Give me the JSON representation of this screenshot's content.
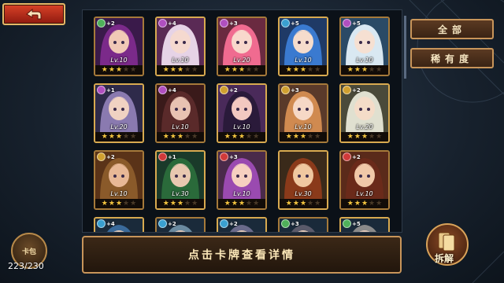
{
  "back_button": {
    "icon": "back-arrow-icon"
  },
  "filters": {
    "all": "全部",
    "rarity": "稀有度"
  },
  "bag": {
    "label": "卡包",
    "count": "223/230"
  },
  "hint": "点击卡牌查看详情",
  "decompose": {
    "label": "拆解"
  },
  "colors": {
    "frame_gold": "#d8aa50",
    "button_red": "#d94228",
    "star_gold": "#f3c43f"
  },
  "cards": [
    {
      "plus": "+2",
      "level": "Lv.10",
      "stars": 3,
      "gem": "#4fb05a",
      "hair": "#7b2a8a",
      "skin": "#f1c9b6",
      "bg": "#3a1a4a"
    },
    {
      "plus": "+4",
      "level": "Lv.10",
      "stars": 3,
      "gem": "#b04fc0",
      "hair": "#e6d3e6",
      "skin": "#f5d9cf",
      "bg": "#5a2a55"
    },
    {
      "plus": "+3",
      "level": "Lv.20",
      "stars": 3,
      "gem": "#b04fc0",
      "hair": "#f06b90",
      "skin": "#f8d8cc",
      "bg": "#6a2a40"
    },
    {
      "plus": "+5",
      "level": "Lv.10",
      "stars": 3,
      "gem": "#3aa0d0",
      "hair": "#3a7ad0",
      "skin": "#f5dccc",
      "bg": "#1f3a66"
    },
    {
      "plus": "+5",
      "level": "Lv.10",
      "stars": 3,
      "gem": "#b04fc0",
      "hair": "#d9e8f2",
      "skin": "#f6e0d2",
      "bg": "#2a4a66"
    },
    {
      "plus": "+1",
      "level": "Lv.20",
      "stars": 3,
      "gem": "#b04fc0",
      "hair": "#8a7ab0",
      "skin": "#f0d2c2",
      "bg": "#2e2a4a"
    },
    {
      "plus": "+4",
      "level": "Lv.10",
      "stars": 3,
      "gem": "#b04fc0",
      "hair": "#5a2a2a",
      "skin": "#e8c2b2",
      "bg": "#3a1a1a"
    },
    {
      "plus": "+2",
      "level": "Lv.10",
      "stars": 3,
      "gem": "#d0a030",
      "hair": "#2a1a3a",
      "skin": "#f2c8c0",
      "bg": "#4a2a5a"
    },
    {
      "plus": "+3",
      "level": "Lv.10",
      "stars": 3,
      "gem": "#d0a030",
      "hair": "#d08a50",
      "skin": "#f6d8c6",
      "bg": "#5a3a2a"
    },
    {
      "plus": "+2",
      "level": "Lv.20",
      "stars": 3,
      "gem": "#d0a030",
      "hair": "#e0e0d0",
      "skin": "#f4dcc8",
      "bg": "#4a4a3a"
    },
    {
      "plus": "+2",
      "level": "Lv.10",
      "stars": 3,
      "gem": "#d0a030",
      "hair": "#8a5a2a",
      "skin": "#e8b896",
      "bg": "#5a3318"
    },
    {
      "plus": "+1",
      "level": "Lv.30",
      "stars": 3,
      "gem": "#d03a3a",
      "hair": "#2a6a3a",
      "skin": "#e8c8b0",
      "bg": "#1a3a2a"
    },
    {
      "plus": "+3",
      "level": "Lv.10",
      "stars": 3,
      "gem": "#d03a3a",
      "hair": "#9a4ab0",
      "skin": "#f6d0c0",
      "bg": "#4a2a4a"
    },
    {
      "plus": "",
      "level": "Lv.30",
      "stars": 3,
      "gem": "#d03a3a",
      "hair": "#8a3a1a",
      "skin": "#f0c8a0",
      "bg": "#3a2a1a"
    },
    {
      "plus": "+2",
      "level": "Lv.10",
      "stars": 3,
      "gem": "#d03a3a",
      "hair": "#6a2a1a",
      "skin": "#f0c8a8",
      "bg": "#5a2a1a"
    },
    {
      "plus": "+4",
      "level": "",
      "stars": 0,
      "gem": "#3aa0d0",
      "hair": "#3a6a9a",
      "skin": "#e0c8b8",
      "bg": "#1a2a3a"
    },
    {
      "plus": "+2",
      "level": "",
      "stars": 0,
      "gem": "#3aa0d0",
      "hair": "#6a8aa0",
      "skin": "#e0c8b8",
      "bg": "#1a2a3a"
    },
    {
      "plus": "+2",
      "level": "",
      "stars": 0,
      "gem": "#3aa0d0",
      "hair": "#6a6a8a",
      "skin": "#e0c8b8",
      "bg": "#1a2a3a"
    },
    {
      "plus": "+3",
      "level": "",
      "stars": 0,
      "gem": "#4fb05a",
      "hair": "#5a5a6a",
      "skin": "#e0c8b8",
      "bg": "#1a2a3a"
    },
    {
      "plus": "+5",
      "level": "",
      "stars": 0,
      "gem": "#4fb05a",
      "hair": "#8a8a8a",
      "skin": "#e0c8b8",
      "bg": "#1a2a3a"
    }
  ]
}
